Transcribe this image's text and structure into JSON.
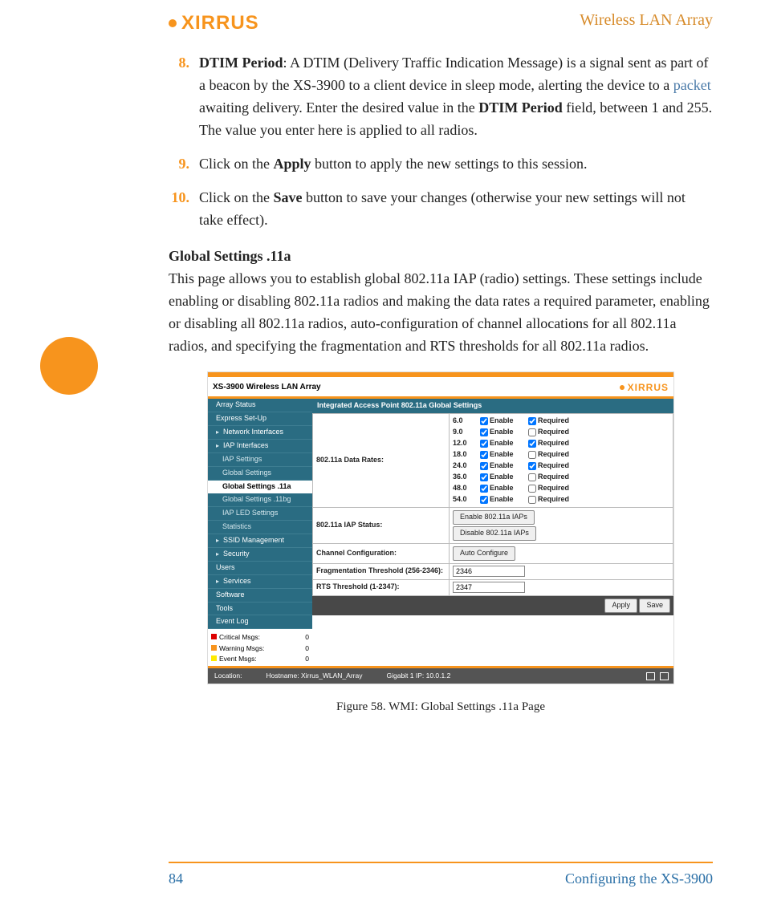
{
  "header": {
    "logo_text": "XIRRUS",
    "title": "Wireless LAN Array"
  },
  "steps": [
    {
      "num": "8.",
      "bold_lead": "DTIM Period",
      "text_before_link": ": A DTIM (Delivery Traffic Indication Message) is a signal sent as part of a beacon by the XS-3900 to a client device in sleep mode, alerting the device to a ",
      "link_text": "packet",
      "text_after_link_1": " awaiting delivery. Enter the desired value in the ",
      "bold_mid": "DTIM Period",
      "text_after_link_2": " field, between 1 and 255. The value you enter here is applied to all radios."
    },
    {
      "num": "9.",
      "text_before": "Click on the ",
      "bold_mid": "Apply",
      "text_after": " button to apply the new settings to this session."
    },
    {
      "num": "10.",
      "text_before": "Click on the ",
      "bold_mid": "Save",
      "text_after": " button to save your changes (otherwise your new settings will not take effect)."
    }
  ],
  "section": {
    "heading": "Global Settings .11a",
    "paragraph": "This page allows you to establish global 802.11a IAP (radio) settings. These settings include enabling or disabling 802.11a radios and making the data rates a required parameter, enabling or disabling all 802.11a radios, auto-configuration of channel allocations for all 802.11a radios, and specifying the fragmentation and RTS thresholds for all 802.11a radios."
  },
  "wmi": {
    "product_title": "XS-3900 Wireless LAN Array",
    "logo": "XIRRUS",
    "nav": {
      "items": [
        "Array Status",
        "Express Set-Up",
        "Network Interfaces",
        "IAP Interfaces"
      ],
      "subs": [
        "IAP Settings",
        "Global Settings"
      ],
      "active": "Global Settings .11a",
      "subs2": [
        "Global Settings .11bg",
        "IAP LED Settings",
        "Statistics"
      ],
      "items2": [
        "SSID Management",
        "Security",
        "Users",
        "Services",
        "Software",
        "Tools",
        "Event Log"
      ]
    },
    "msgs": {
      "critical_label": "Critical Msgs:",
      "critical_value": "0",
      "warning_label": "Warning Msgs:",
      "warning_value": "0",
      "event_label": "Event Msgs:",
      "event_value": "0"
    },
    "panel_title": "Integrated Access Point 802.11a Global Settings",
    "rows": {
      "data_rates_label": "802.11a Data Rates:",
      "iap_status_label": "802.11a IAP Status:",
      "channel_label": "Channel Configuration:",
      "frag_label": "Fragmentation Threshold (256-2346):",
      "frag_value": "2346",
      "rts_label": "RTS Threshold (1-2347):",
      "rts_value": "2347"
    },
    "rates": [
      {
        "rate": "6.0",
        "enable": true,
        "required": true
      },
      {
        "rate": "9.0",
        "enable": true,
        "required": false
      },
      {
        "rate": "12.0",
        "enable": true,
        "required": true
      },
      {
        "rate": "18.0",
        "enable": true,
        "required": false
      },
      {
        "rate": "24.0",
        "enable": true,
        "required": true
      },
      {
        "rate": "36.0",
        "enable": true,
        "required": false
      },
      {
        "rate": "48.0",
        "enable": true,
        "required": false
      },
      {
        "rate": "54.0",
        "enable": true,
        "required": false
      }
    ],
    "rate_headers": {
      "enable": "Enable",
      "required": "Required"
    },
    "buttons": {
      "enable_iaps": "Enable 802.11a IAPs",
      "disable_iaps": "Disable 802.11a IAPs",
      "auto_configure": "Auto Configure",
      "apply": "Apply",
      "save": "Save"
    },
    "footer": {
      "location_label": "Location:",
      "hostname_label": "Hostname: Xirrus_WLAN_Array",
      "ip_label": "Gigabit 1 IP: 10.0.1.2"
    }
  },
  "figure_caption": "Figure 58. WMI: Global Settings .11a Page",
  "footer": {
    "page_number": "84",
    "section": "Configuring the XS-3900"
  }
}
